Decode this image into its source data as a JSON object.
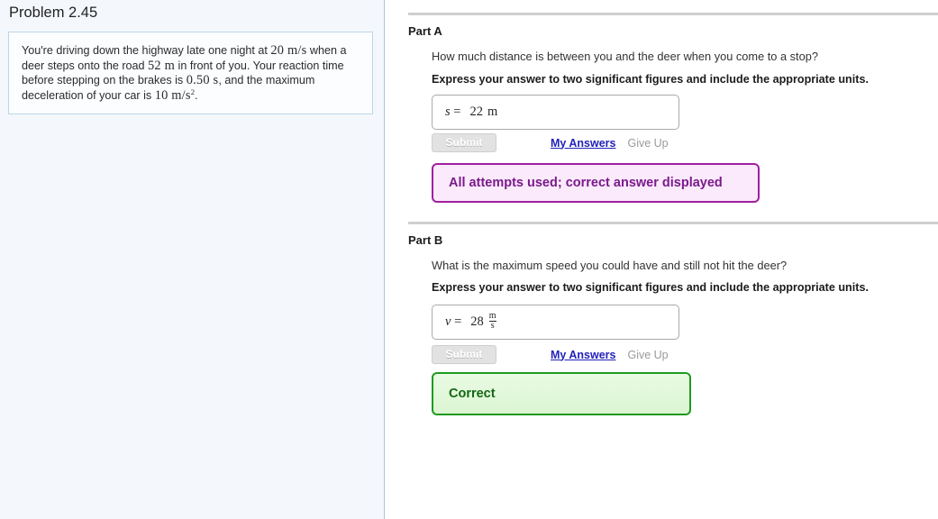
{
  "left": {
    "title": "Problem 2.45",
    "statement": {
      "seg1": "You're driving down the highway late one night at ",
      "v0": "20 m/s",
      "seg2": " when a deer steps onto the road ",
      "d0": "52 m",
      "seg3": " in front of you. Your reaction time before stepping on the brakes is ",
      "t0": "0.50 s",
      "seg4": ", and the maximum deceleration of your car is ",
      "a0": "10 m/s",
      "a0sup": "2",
      "seg5": "."
    }
  },
  "parts": [
    {
      "label": "Part A",
      "question": "How much distance is between you and the deer when you come to a stop?",
      "instruction": "Express your answer to two significant figures and include the appropriate units.",
      "answer": {
        "variable": "s",
        "equals": "=",
        "value": "22",
        "unit": "m",
        "unit_style": "inline"
      },
      "submit_label": "Submit",
      "my_answers_label": "My Answers",
      "give_up_label": "Give Up",
      "feedback": {
        "text": "All attempts used; correct answer displayed",
        "style": "purple"
      }
    },
    {
      "label": "Part B",
      "question": "What is the maximum speed you could have and still not hit the deer?",
      "instruction": "Express your answer to two significant figures and include the appropriate units.",
      "answer": {
        "variable": "v",
        "equals": "=",
        "value": "28",
        "unit_numerator": "m",
        "unit_denominator": "s",
        "unit_style": "fraction"
      },
      "submit_label": "Submit",
      "my_answers_label": "My Answers",
      "give_up_label": "Give Up",
      "feedback": {
        "text": "Correct",
        "style": "green"
      }
    }
  ],
  "colors": {
    "panel_background": "#f4f8fd",
    "panel_border": "#aec3d8",
    "problem_box_border": "#bdd6e8",
    "divider": "#cfcfcf",
    "link": "#2222bb",
    "purple_border": "#a020a0",
    "purple_fill": "#fbeafb",
    "purple_text": "#7a1a8c",
    "green_border": "#1f9a1f",
    "green_fill": "#e4f8dc",
    "green_text": "#146614"
  }
}
